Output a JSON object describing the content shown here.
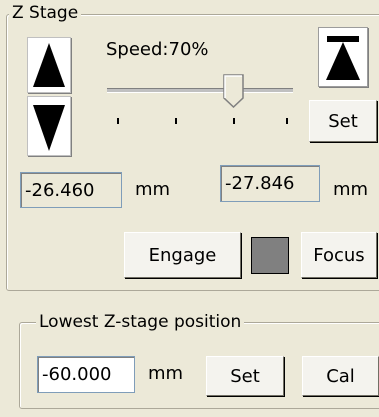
{
  "z_stage": {
    "title": "Z Stage",
    "speed_label": "Speed:70%",
    "speed_percent": 70,
    "up_icon": "arrow-up-icon",
    "down_icon": "arrow-down-icon",
    "top_icon": "arrow-to-top-icon",
    "set_label": "Set",
    "position_left": "-26.460",
    "position_right": "-27.846",
    "unit": "mm",
    "engage_label": "Engage",
    "focus_label": "Focus",
    "indicator_color": "#808080"
  },
  "lowest": {
    "title": "Lowest Z-stage position",
    "value": "-60.000",
    "unit": "mm",
    "set_label": "Set",
    "cal_label": "Cal"
  }
}
